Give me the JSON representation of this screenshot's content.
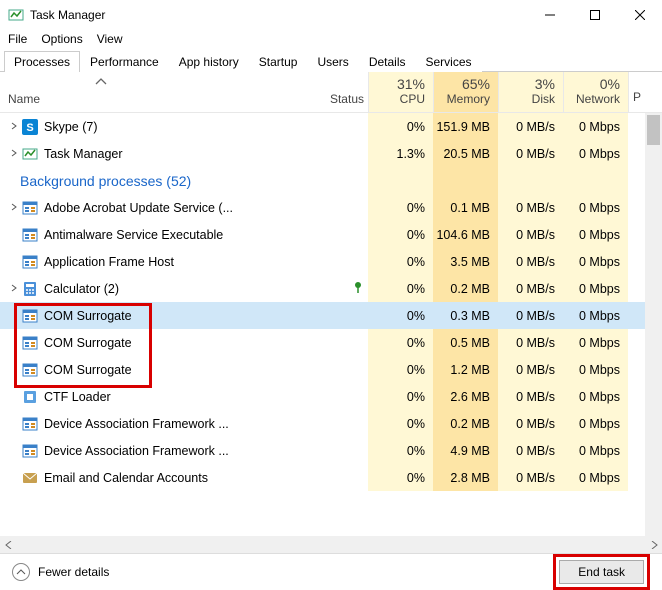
{
  "window": {
    "title": "Task Manager",
    "menus": [
      "File",
      "Options",
      "View"
    ]
  },
  "tabs": [
    "Processes",
    "Performance",
    "App history",
    "Startup",
    "Users",
    "Details",
    "Services"
  ],
  "active_tab_index": 0,
  "columns": {
    "name": "Name",
    "status": "Status",
    "cpu": {
      "pct": "31%",
      "label": "CPU"
    },
    "memory": {
      "pct": "65%",
      "label": "Memory"
    },
    "disk": {
      "pct": "3%",
      "label": "Disk"
    },
    "network": {
      "pct": "0%",
      "label": "Network"
    },
    "p": "P"
  },
  "rows": [
    {
      "kind": "proc",
      "expand": true,
      "icon": "skype",
      "name": "Skype (7)",
      "cpu": "0%",
      "mem": "151.9 MB",
      "disk": "0 MB/s",
      "net": "0 Mbps"
    },
    {
      "kind": "proc",
      "expand": true,
      "icon": "taskmgr",
      "name": "Task Manager",
      "cpu": "1.3%",
      "mem": "20.5 MB",
      "disk": "0 MB/s",
      "net": "0 Mbps"
    },
    {
      "kind": "group",
      "label": "Background processes (52)"
    },
    {
      "kind": "proc",
      "expand": true,
      "icon": "generic",
      "name": "Adobe Acrobat Update Service (...",
      "cpu": "0%",
      "mem": "0.1 MB",
      "disk": "0 MB/s",
      "net": "0 Mbps"
    },
    {
      "kind": "proc",
      "expand": false,
      "icon": "generic",
      "name": "Antimalware Service Executable",
      "cpu": "0%",
      "mem": "104.6 MB",
      "disk": "0 MB/s",
      "net": "0 Mbps"
    },
    {
      "kind": "proc",
      "expand": false,
      "icon": "generic",
      "name": "Application Frame Host",
      "cpu": "0%",
      "mem": "3.5 MB",
      "disk": "0 MB/s",
      "net": "0 Mbps"
    },
    {
      "kind": "proc",
      "expand": true,
      "icon": "calc",
      "name": "Calculator (2)",
      "leaf": true,
      "cpu": "0%",
      "mem": "0.2 MB",
      "disk": "0 MB/s",
      "net": "0 Mbps"
    },
    {
      "kind": "proc",
      "expand": false,
      "icon": "generic",
      "name": "COM Surrogate",
      "selected": true,
      "cpu": "0%",
      "mem": "0.3 MB",
      "disk": "0 MB/s",
      "net": "0 Mbps"
    },
    {
      "kind": "proc",
      "expand": false,
      "icon": "generic",
      "name": "COM Surrogate",
      "cpu": "0%",
      "mem": "0.5 MB",
      "disk": "0 MB/s",
      "net": "0 Mbps"
    },
    {
      "kind": "proc",
      "expand": false,
      "icon": "generic",
      "name": "COM Surrogate",
      "cpu": "0%",
      "mem": "1.2 MB",
      "disk": "0 MB/s",
      "net": "0 Mbps"
    },
    {
      "kind": "proc",
      "expand": false,
      "icon": "ctf",
      "name": "CTF Loader",
      "cpu": "0%",
      "mem": "2.6 MB",
      "disk": "0 MB/s",
      "net": "0 Mbps"
    },
    {
      "kind": "proc",
      "expand": false,
      "icon": "generic",
      "name": "Device Association Framework ...",
      "cpu": "0%",
      "mem": "0.2 MB",
      "disk": "0 MB/s",
      "net": "0 Mbps"
    },
    {
      "kind": "proc",
      "expand": false,
      "icon": "generic",
      "name": "Device Association Framework ...",
      "cpu": "0%",
      "mem": "4.9 MB",
      "disk": "0 MB/s",
      "net": "0 Mbps"
    },
    {
      "kind": "proc",
      "expand": false,
      "icon": "mail",
      "name": "Email and Calendar Accounts",
      "cpu": "0%",
      "mem": "2.8 MB",
      "disk": "0 MB/s",
      "net": "0 Mbps"
    }
  ],
  "footer": {
    "fewer_details": "Fewer details",
    "end_task": "End task"
  }
}
